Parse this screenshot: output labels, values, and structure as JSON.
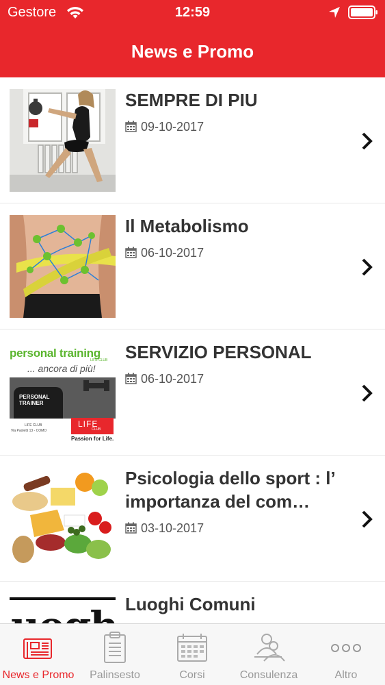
{
  "status_bar": {
    "carrier": "Gestore",
    "time": "12:59"
  },
  "header": {
    "title": "News e Promo",
    "background_color": "#e8272c"
  },
  "news": [
    {
      "title": "SEMPRE DI PIU",
      "date": "09-10-2017",
      "thumbnail": "woman-kettlebell-workout"
    },
    {
      "title": "Il Metabolismo",
      "date": "06-10-2017",
      "thumbnail": "waist-measuring-tape-molecules"
    },
    {
      "title": "SERVIZIO PERSONAL",
      "date": "06-10-2017",
      "thumbnail": "personal-training-flyer",
      "thumb_text": {
        "headline": "personal training",
        "brand_small": "LIFE CLUB",
        "subline": "... ancora di più!",
        "shirt": "PERSONAL TRAINER",
        "club": "LIFE CLUB",
        "address": "Via Paoletti 13 - COMO",
        "logo": "LIFE",
        "logo_small": "CLUB",
        "tagline": "Passion for Life."
      }
    },
    {
      "title": "Psicologia dello sport : l’ importanza del com…",
      "date": "03-10-2017",
      "thumbnail": "healthy-food-spread"
    },
    {
      "title": "Luoghi Comuni",
      "date": "",
      "thumbnail": "black-lettering-sign",
      "thumb_text": "uogh"
    }
  ],
  "tabs": [
    {
      "label": "News e Promo",
      "icon": "newspaper-icon",
      "active": true
    },
    {
      "label": "Palinsesto",
      "icon": "clipboard-icon",
      "active": false
    },
    {
      "label": "Corsi",
      "icon": "calendar-icon",
      "active": false
    },
    {
      "label": "Consulenza",
      "icon": "people-icon",
      "active": false
    },
    {
      "label": "Altro",
      "icon": "more-icon",
      "active": false
    }
  ],
  "colors": {
    "accent": "#e8272c",
    "inactive_tab": "#999999"
  }
}
